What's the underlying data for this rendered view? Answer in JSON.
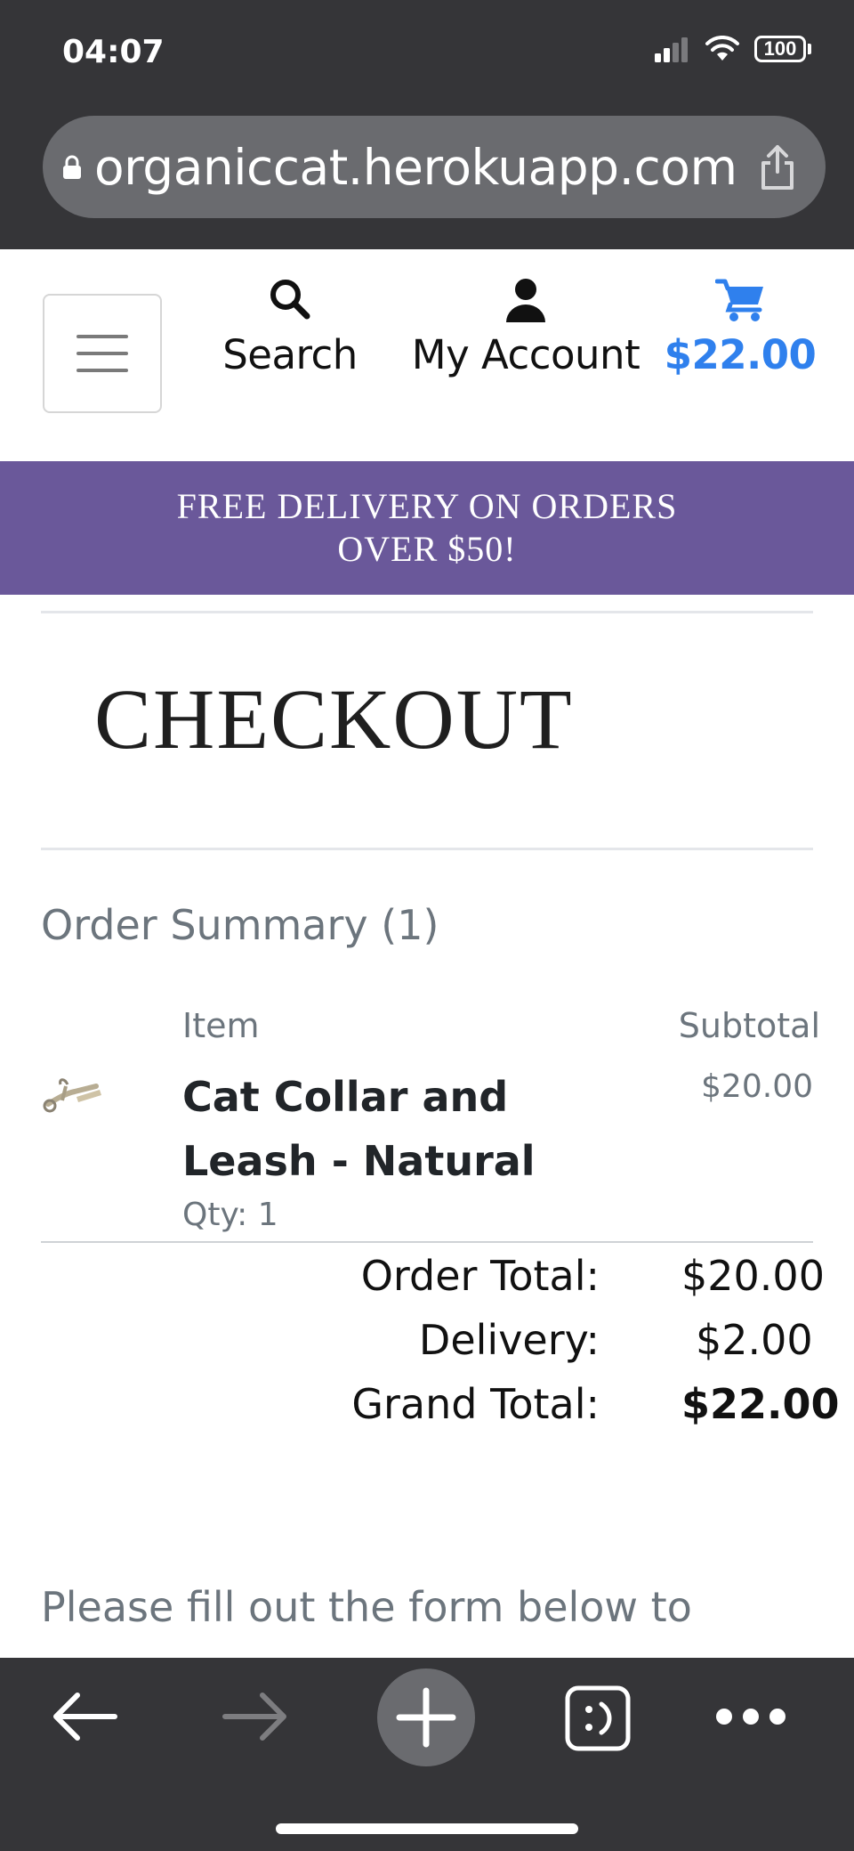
{
  "status_bar": {
    "time": "04:07",
    "battery": "100"
  },
  "browser": {
    "url": "organiccat.herokuapp.com"
  },
  "header": {
    "search_label": "Search",
    "account_label": "My Account",
    "cart_total": "$22.00",
    "cart_color": "#2f80ed"
  },
  "promo": {
    "text": "FREE DELIVERY ON ORDERS OVER $50!",
    "background": "#6a589a"
  },
  "page": {
    "title": "CHECKOUT"
  },
  "order": {
    "summary_label": "Order Summary (1)",
    "headers": {
      "item": "Item",
      "subtotal": "Subtotal"
    },
    "items": [
      {
        "name": "Cat Collar and Leash - Natural",
        "qty": "Qty: 1",
        "subtotal": "$20.00"
      }
    ],
    "totals": {
      "order_total_label": "Order Total:",
      "order_total": "$20.00",
      "delivery_label": "Delivery:",
      "delivery": "$2.00",
      "grand_total_label": "Grand Total:",
      "grand_total": "$22.00"
    }
  },
  "form": {
    "intro": "Please fill out the form below to complete your order"
  },
  "toolbar": {
    "icons": [
      "back-arrow-icon",
      "forward-arrow-icon",
      "new-tab-plus-icon",
      "tabs-icon",
      "more-icon"
    ]
  }
}
